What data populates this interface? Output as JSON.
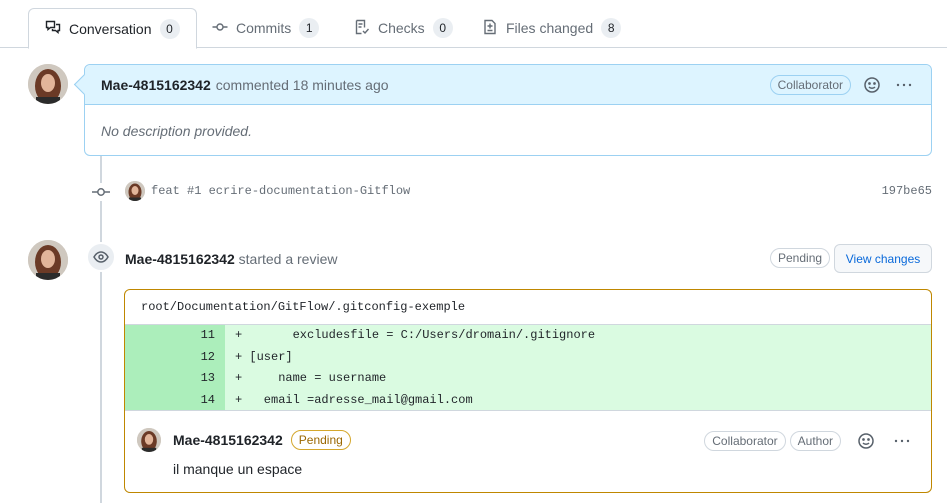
{
  "tabs": [
    {
      "label": "Conversation",
      "count": "0",
      "icon": "comment-discussion-icon"
    },
    {
      "label": "Commits",
      "count": "1",
      "icon": "git-commit-icon"
    },
    {
      "label": "Checks",
      "count": "0",
      "icon": "checklist-icon"
    },
    {
      "label": "Files changed",
      "count": "8",
      "icon": "file-diff-icon"
    }
  ],
  "comment": {
    "author": "Mae-4815162342",
    "action": "commented 18 minutes ago",
    "role": "Collaborator",
    "body": "No description provided."
  },
  "commit": {
    "message": "feat #1 ecrire-documentation-Gitflow",
    "sha": "197be65"
  },
  "review": {
    "author": "Mae-4815162342",
    "action": "started a review",
    "status": "Pending",
    "view_changes": "View changes",
    "file_path": "root/Documentation/GitFlow/.gitconfig-exemple",
    "lines": [
      {
        "num": "11",
        "code": "+       excludesfile = C:/Users/dromain/.gitignore"
      },
      {
        "num": "12",
        "code": "+ [user]"
      },
      {
        "num": "13",
        "code": "+     name = username"
      },
      {
        "num": "14",
        "code": "+   email =adresse_mail@gmail.com"
      }
    ],
    "reply": {
      "author": "Mae-4815162342",
      "status": "Pending",
      "role1": "Collaborator",
      "role2": "Author",
      "text": "il manque un espace"
    }
  },
  "colors": {
    "accent": "#0969da",
    "comment_header_bg": "#ddf4ff",
    "diff_add_bg": "#dafbe1",
    "diff_add_num_bg": "#aceebb",
    "pending_border": "#bf8700"
  }
}
